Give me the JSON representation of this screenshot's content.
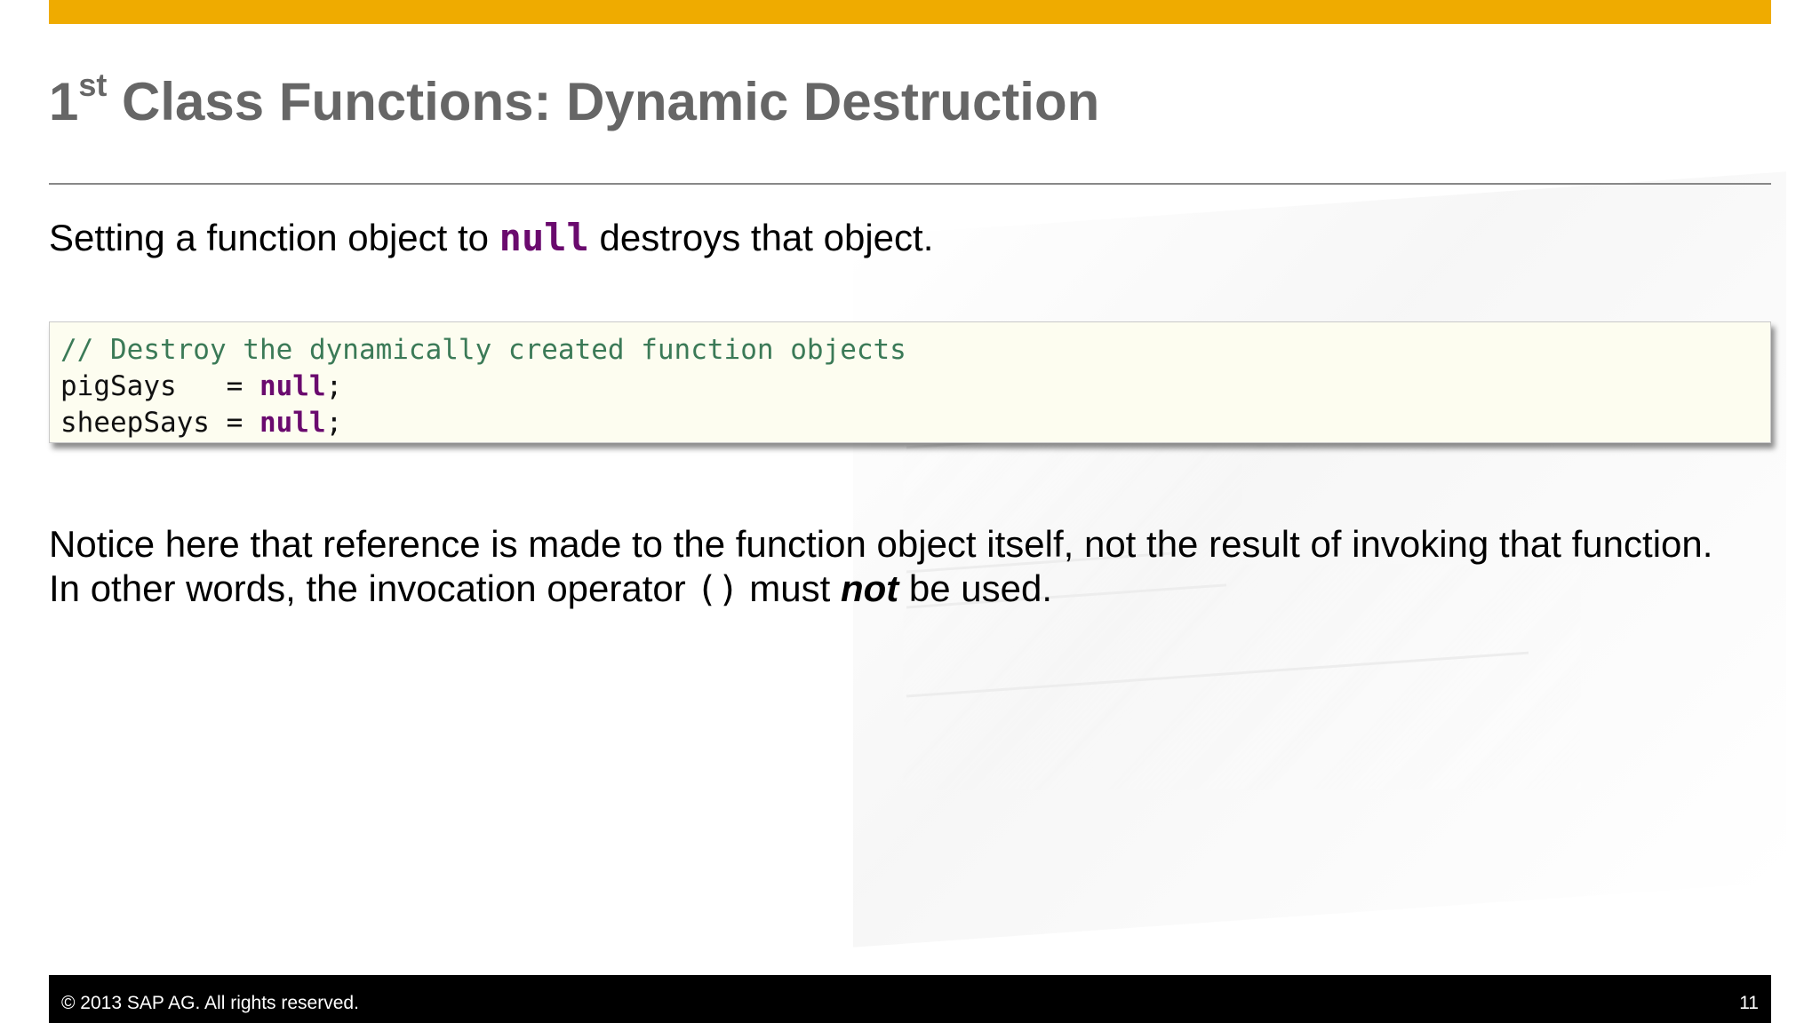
{
  "slide": {
    "title_prefix": "1",
    "title_superscript": "st",
    "title_rest": " Class Functions: Dynamic Destruction",
    "intro": {
      "before": "Setting a function object to ",
      "keyword": "null",
      "after": " destroys that object."
    },
    "code": {
      "comment": "// Destroy the dynamically created function objects",
      "line1_lhs": "pigSays   = ",
      "line1_kw": "null",
      "line1_end": ";",
      "line2_lhs": "sheepSays = ",
      "line2_kw": "null",
      "line2_end": ";"
    },
    "notice": {
      "line1": "Notice here that reference is made to the function object itself, not the result of invoking that function.",
      "line2_before": "In other words, the invocation operator ",
      "line2_operator": "()",
      "line2_middle": " must ",
      "line2_emphasis": "not",
      "line2_after": " be used."
    }
  },
  "footer": {
    "copyright": "©  2013 SAP AG. All rights reserved.",
    "page_number": "11"
  },
  "colors": {
    "accent_bar": "#efab00",
    "title": "#666666",
    "keyword": "#6a0a6e",
    "comment": "#3b7a57",
    "code_background": "#fdfdf0",
    "footer_background": "#000000"
  }
}
